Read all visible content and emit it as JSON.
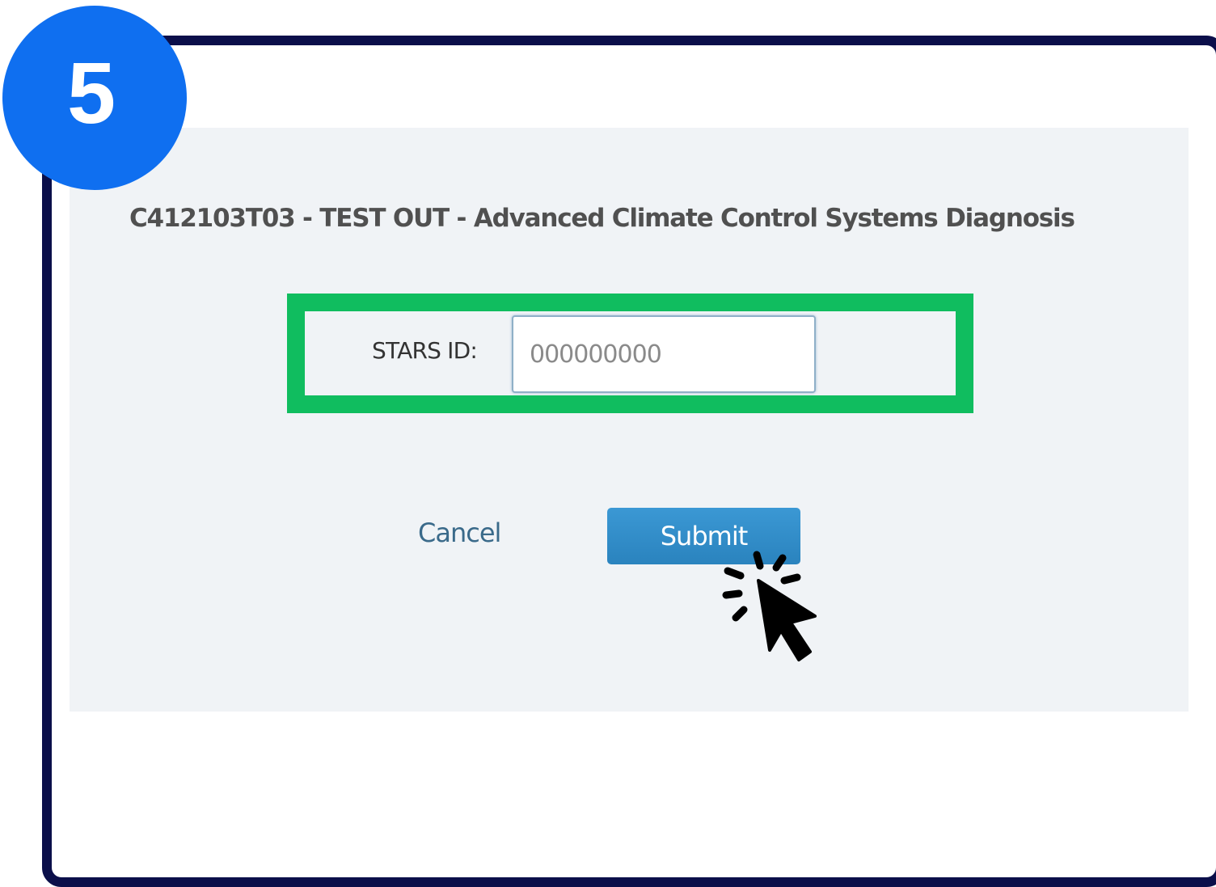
{
  "step": {
    "number": "5",
    "badge_color": "#0f6ff0"
  },
  "frame": {
    "border_color": "#0b0f4a"
  },
  "dialog": {
    "course_title": "C412103T03 - TEST OUT - Advanced Climate Control Systems Diagnosis",
    "stars_id": {
      "label": "STARS ID:",
      "value": "000000000"
    },
    "cancel_label": "Cancel",
    "submit_label": "Submit",
    "submit_color": "#2a8bc9"
  },
  "annotations": {
    "highlight_color": "#10bd5f",
    "highlight_target": "stars-id-field",
    "cursor_icon": "click-pointer-icon"
  }
}
